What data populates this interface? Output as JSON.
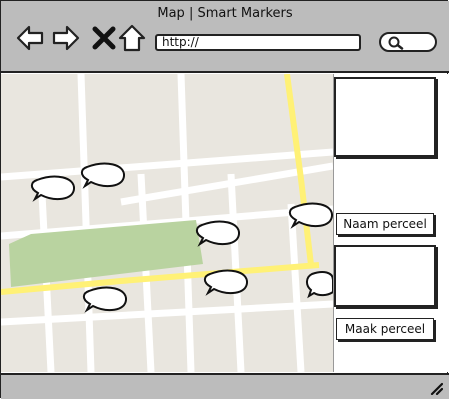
{
  "window": {
    "title": "Map | Smart Markers"
  },
  "browser": {
    "back_icon": "arrow-left-icon",
    "forward_icon": "arrow-right-icon",
    "stop_icon": "close-icon",
    "home_icon": "home-icon",
    "url_value": "http://",
    "search_icon": "search-icon"
  },
  "colors": {
    "chrome": "#bcbcbc",
    "map_background": "#e9e6df",
    "road_highlight": "#fff176",
    "park": "#b9d3a0",
    "street": "#ffffff"
  },
  "sidebar": {
    "name_button_label": "Naam perceel",
    "create_button_label": "Maak perceel"
  },
  "statusbar": {
    "resize_icon": "resize-grip-icon"
  }
}
